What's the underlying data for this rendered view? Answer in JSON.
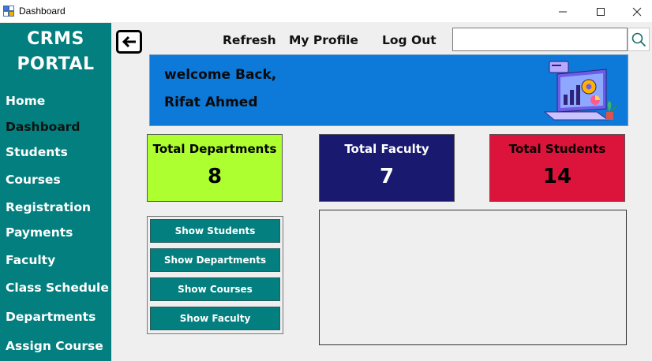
{
  "window": {
    "title": "Dashboard",
    "icon": "form-icon",
    "controls": [
      "minimize-icon",
      "maximize-icon",
      "close-icon"
    ]
  },
  "sidebar": {
    "brand_line1": "CRMS",
    "brand_line2": "PORTAL",
    "items": [
      {
        "label": "Home",
        "active": false
      },
      {
        "label": "Dashboard",
        "active": true
      },
      {
        "label": "Students",
        "active": false
      },
      {
        "label": "Courses",
        "active": false
      },
      {
        "label": "Registration",
        "active": false
      },
      {
        "label": "Payments",
        "active": false
      },
      {
        "label": "Faculty",
        "active": false
      },
      {
        "label": "Class Schedule",
        "active": false
      },
      {
        "label": "Departments",
        "active": false
      },
      {
        "label": "Assign Course",
        "active": false
      }
    ]
  },
  "header": {
    "back_icon": "arrow-left-icon",
    "refresh_label": "Refresh",
    "profile_label": "My Profile",
    "logout_label": "Log Out",
    "search_value": "",
    "search_icon": "search-icon"
  },
  "welcome": {
    "line1": "welcome Back,",
    "line2": "Rifat Ahmed",
    "illustration": "dashboard-illustration-icon"
  },
  "stats": [
    {
      "label": "Total Departments",
      "value": "8",
      "bg": "#adff2f",
      "fg": "#000000"
    },
    {
      "label": "Total Faculty",
      "value": "7",
      "bg": "#191970",
      "fg": "#ffffff"
    },
    {
      "label": "Total Students",
      "value": "14",
      "bg": "#dc143c",
      "fg": "#000000"
    }
  ],
  "actions": [
    {
      "label": "Show Students"
    },
    {
      "label": "Show Departments"
    },
    {
      "label": "Show Courses"
    },
    {
      "label": "Show Faculty"
    }
  ],
  "colors": {
    "sidebar": "#037f7f",
    "banner": "#0d79d9",
    "button": "#037f7f"
  }
}
